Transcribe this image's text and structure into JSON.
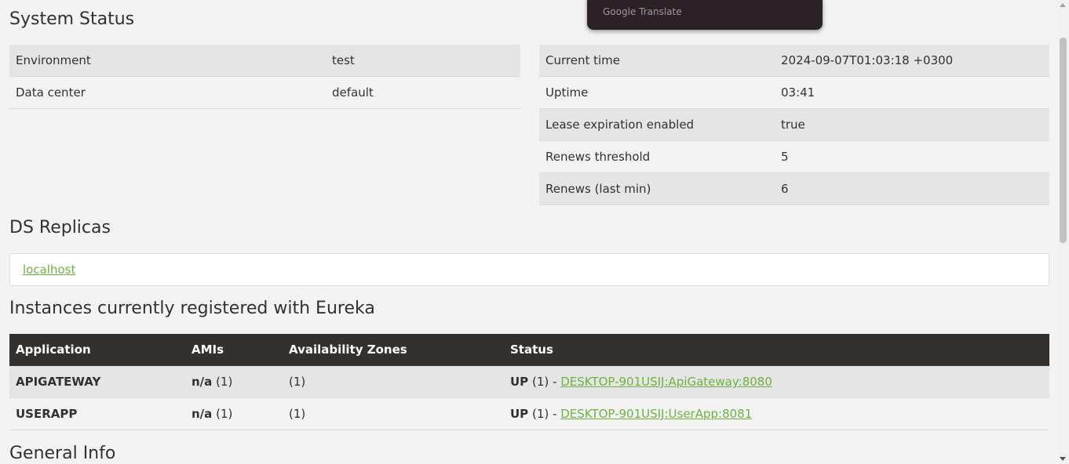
{
  "system_status": {
    "title": "System Status",
    "left": [
      {
        "key": "Environment",
        "value": "test"
      },
      {
        "key": "Data center",
        "value": "default"
      }
    ],
    "right": [
      {
        "key": "Current time",
        "value": "2024-09-07T01:03:18 +0300"
      },
      {
        "key": "Uptime",
        "value": "03:41"
      },
      {
        "key": "Lease expiration enabled",
        "value": "true"
      },
      {
        "key": "Renews threshold",
        "value": "5"
      },
      {
        "key": "Renews (last min)",
        "value": "6"
      }
    ]
  },
  "ds_replicas": {
    "title": "DS Replicas",
    "link": "localhost"
  },
  "instances": {
    "title": "Instances currently registered with Eureka",
    "headers": [
      "Application",
      "AMIs",
      "Availability Zones",
      "Status"
    ],
    "rows": [
      {
        "app": "APIGATEWAY",
        "ami_bold": "n/a",
        "ami_count": "(1)",
        "zones": "(1)",
        "status_bold": "UP",
        "status_count": "(1) -",
        "status_link": "DESKTOP-901USIJ:ApiGateway:8080"
      },
      {
        "app": "USERAPP",
        "ami_bold": "n/a",
        "ami_count": "(1)",
        "zones": "(1)",
        "status_bold": "UP",
        "status_count": "(1) -",
        "status_link": "DESKTOP-901USIJ:UserApp:8081"
      }
    ]
  },
  "general_info": {
    "title": "General Info"
  },
  "translate_popup": {
    "label": "Google Translate"
  },
  "colors": {
    "accent_link": "#6db33f",
    "header_bg": "#34302d"
  }
}
